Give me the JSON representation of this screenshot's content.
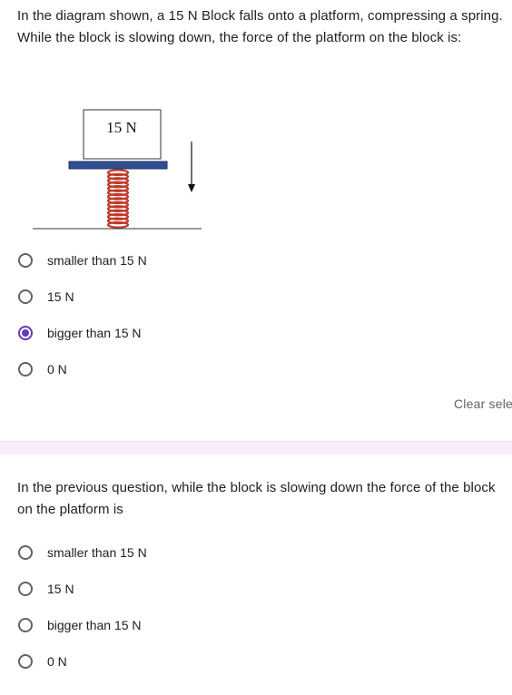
{
  "question1": {
    "text": "In the diagram shown, a 15 N Block falls onto a platform, compressing a spring. While the block is slowing down, the force of the platform on the block is:",
    "diagram": {
      "block_label": "15 N",
      "direction": "down"
    },
    "options": [
      {
        "label": "smaller than 15 N",
        "selected": false
      },
      {
        "label": "15 N",
        "selected": false
      },
      {
        "label": "bigger than 15 N",
        "selected": true
      },
      {
        "label": "0 N",
        "selected": false
      }
    ],
    "clear_label": "Clear sele"
  },
  "question2": {
    "text": "In the previous question, while the block is slowing down the force of the block on the platform is",
    "options": [
      {
        "label": "smaller than 15 N",
        "selected": false
      },
      {
        "label": "15 N",
        "selected": false
      },
      {
        "label": "bigger than 15 N",
        "selected": false
      },
      {
        "label": "0 N",
        "selected": false
      }
    ]
  },
  "colors": {
    "accent": "#673ab7",
    "text": "#202124",
    "muted": "#5f6368",
    "platform": "#2f4f8f",
    "spring": "#c0392b",
    "band": "#f6eefb"
  }
}
